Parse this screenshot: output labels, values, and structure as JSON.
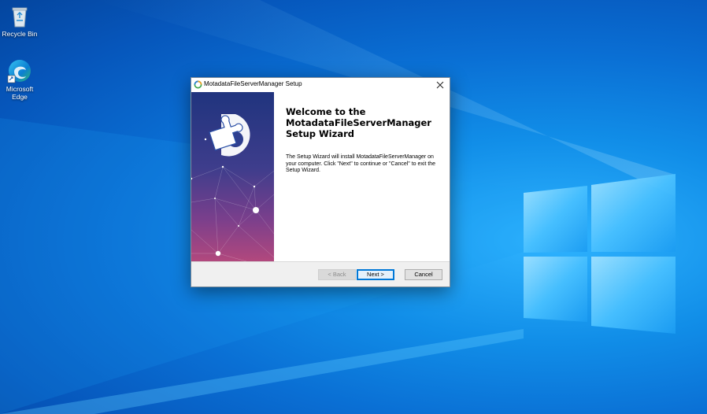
{
  "desktop": {
    "icons": [
      {
        "label": "Recycle Bin",
        "icon": "recycle-bin-icon"
      },
      {
        "label": "Microsoft Edge",
        "icon": "edge-icon"
      }
    ]
  },
  "dialog": {
    "title": "MotadataFileServerManager Setup",
    "heading": [
      "Welcome to the",
      "MotadataFileServerManager",
      "Setup Wizard"
    ],
    "description": "The Setup Wizard will install MotadataFileServerManager on your computer.  Click \"Next\" to continue or \"Cancel\" to exit the Setup Wizard.",
    "buttons": {
      "back": "< Back",
      "next": "Next >",
      "cancel": "Cancel"
    }
  },
  "colors": {
    "desktop_blue": "#0a6fd4",
    "panel_top": "#20347e",
    "panel_bottom": "#b2487d",
    "focus_blue": "#0078d7"
  }
}
